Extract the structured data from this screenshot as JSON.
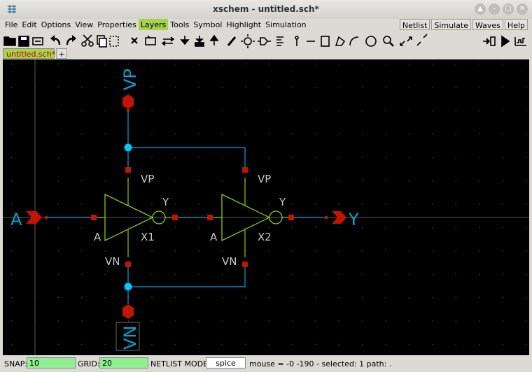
{
  "window": {
    "title": "xschem - untitled.sch*"
  },
  "menu": [
    "File",
    "Edit",
    "Options",
    "View",
    "Properties",
    "Layers",
    "Tools",
    "Symbol",
    "Highlight",
    "Simulation"
  ],
  "menu_active": "Layers",
  "menu_right": [
    "Netlist",
    "Simulate",
    "Waves",
    "Help"
  ],
  "tabs": [
    {
      "label": "untitled.sch*",
      "active": true
    },
    {
      "label": "+",
      "active": false
    }
  ],
  "toolbar_icons": [
    "open-icon",
    "save-icon",
    "reload-icon",
    "undo-icon",
    "redo-icon",
    "cut-icon",
    "copy-icon",
    "paste-icon",
    "delete-icon",
    "select-icon",
    "move-icon",
    "push-icon",
    "descend-icon",
    "ascend-icon",
    "wire-icon",
    "line-icon",
    "bus-icon",
    "text-icon",
    "pin-icon",
    "rect-icon",
    "polygon-icon",
    "arc-icon",
    "circle-icon",
    "zoom-icon",
    "zoom-in-icon",
    "zoom-out-icon",
    "netlist-icon",
    "simulate-icon",
    "waves-icon"
  ],
  "schematic": {
    "colors": {
      "wire": "#0089c4",
      "pin": "#c01500",
      "label": "#00a6d6",
      "gate": "#8acc00",
      "text": "#c8c8c8",
      "dot": "#00c8ff"
    },
    "ports": {
      "top": "VP",
      "bottom": "VN",
      "left": "A",
      "right": "Y"
    },
    "instances": [
      {
        "name": "X1",
        "in": "A",
        "out": "Y",
        "vp": "VP",
        "vn": "VN"
      },
      {
        "name": "X2",
        "in": "A",
        "out": "Y",
        "vp": "VP",
        "vn": "VN"
      }
    ]
  },
  "status": {
    "snap_label": "SNAP:",
    "snap_value": "10",
    "grid_label": "GRID:",
    "grid_value": "20",
    "netlist_label": "NETLIST MODE:",
    "netlist_value": "spice",
    "message": "mouse = -0 -190 - selected: 1 path: ."
  }
}
